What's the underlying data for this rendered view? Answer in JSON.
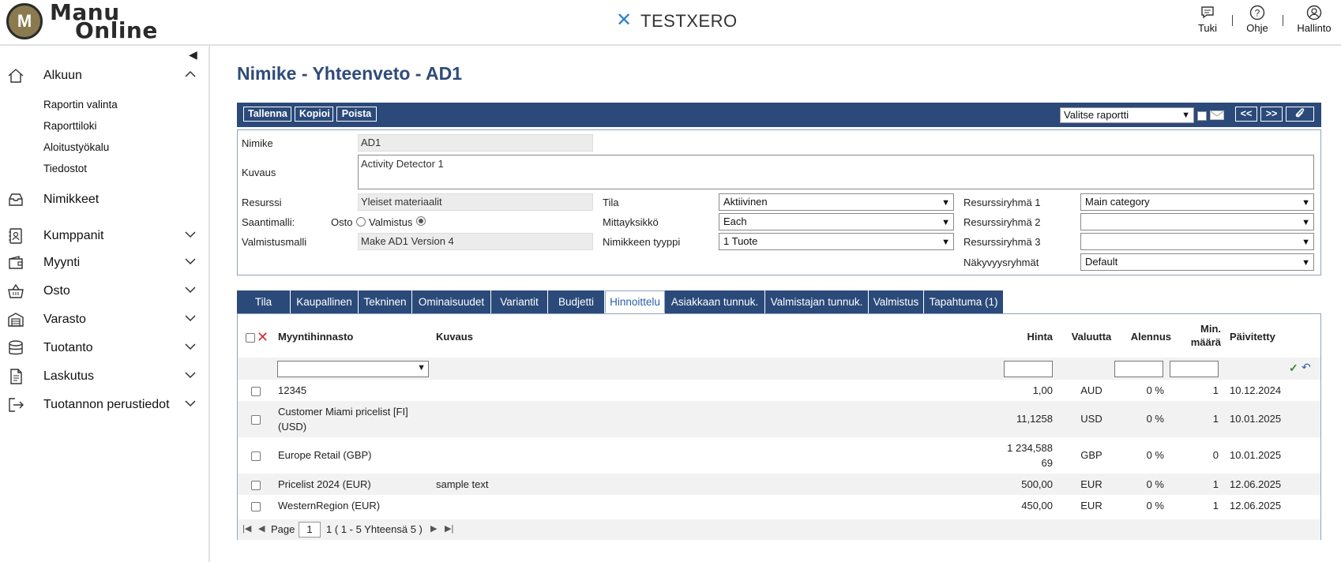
{
  "header": {
    "logo_mark": "M",
    "logo_line1": "Manu",
    "logo_line2": "Online",
    "brand_icon": "⌘",
    "brand_name": "TESTXERO",
    "tools": [
      {
        "label": "Tuki",
        "icon": "chat-icon"
      },
      {
        "label": "Ohje",
        "icon": "help-icon"
      },
      {
        "label": "Hallinto",
        "icon": "user-icon"
      }
    ]
  },
  "sidebar": {
    "collapse_icon": "chevron-left-icon",
    "main": [
      {
        "label": "Alkuun",
        "icon": "home-icon",
        "chevron": "⌃"
      },
      {
        "label": "Nimikkeet",
        "icon": "inbox-icon",
        "chevron": ""
      },
      {
        "label": "Kumppanit",
        "icon": "contacts-icon",
        "chevron": "⌄"
      },
      {
        "label": "Myynti",
        "icon": "wallet-icon",
        "chevron": "⌄"
      },
      {
        "label": "Osto",
        "icon": "basket-icon",
        "chevron": "⌄"
      },
      {
        "label": "Varasto",
        "icon": "warehouse-icon",
        "chevron": "⌄"
      },
      {
        "label": "Tuotanto",
        "icon": "database-icon",
        "chevron": "⌄"
      },
      {
        "label": "Laskutus",
        "icon": "invoice-icon",
        "chevron": "⌄"
      },
      {
        "label": "Tuotannon perustiedot",
        "icon": "exit-icon",
        "chevron": "⌄"
      }
    ],
    "sub": [
      "Raportin valinta",
      "Raporttiloki",
      "Aloitustyökalu",
      "Tiedostot"
    ]
  },
  "page": {
    "title": "Nimike - Yhteenveto - AD1"
  },
  "toolbar": {
    "save": "Tallenna",
    "copy": "Kopioi",
    "delete": "Poista",
    "report_select": "Valitse raportti",
    "prev": "<<",
    "next": ">>",
    "attach": "✎"
  },
  "form": {
    "nimike_label": "Nimike",
    "nimike_value": "AD1",
    "kuvaus_label": "Kuvaus",
    "kuvaus_value": "Activity Detector 1",
    "resurssi_label": "Resurssi",
    "resurssi_value": "Yleiset materiaalit",
    "saantimalli_label": "Saantimalli:",
    "osto_label": "Osto",
    "valmistus_label": "Valmistus",
    "valmistusmalli_label": "Valmistusmalli",
    "valmistusmalli_value": "Make AD1 Version 4",
    "tila_label": "Tila",
    "tila_value": "Aktiivinen",
    "mittayksikko_label": "Mittayksikkö",
    "mittayksikko_value": "Each",
    "tyyppi_label": "Nimikkeen tyyppi",
    "tyyppi_value": "1 Tuote",
    "rr1_label": "Resurssiryhmä 1",
    "rr1_value": "Main category",
    "rr2_label": "Resurssiryhmä 2",
    "rr2_value": "",
    "rr3_label": "Resurssiryhmä 3",
    "rr3_value": "",
    "nakyvyys_label": "Näkyvyysryhmät",
    "nakyvyys_value": "Default"
  },
  "tabs": [
    "Tila",
    "Kaupallinen",
    "Tekninen",
    "Ominaisuudet",
    "Variantit",
    "Budjetti",
    "Hinnoittelu",
    "Asiakkaan tunnuk.",
    "Valmistajan tunnuk.",
    "Valmistus",
    "Tapahtuma (1)"
  ],
  "active_tab": "Hinnoittelu",
  "grid": {
    "headers": {
      "pricelist": "Myyntihinnasto",
      "description": "Kuvaus",
      "price": "Hinta",
      "currency": "Valuutta",
      "discount": "Alennus",
      "minqty_1": "Min.",
      "minqty_2": "määrä",
      "updated": "Päivitetty"
    },
    "rows": [
      {
        "pricelist": "12345",
        "pricelist2": "",
        "description": "",
        "price": "1,00",
        "price2": "",
        "currency": "AUD",
        "discount": "0 %",
        "minqty": "1",
        "updated": "10.12.2024"
      },
      {
        "pricelist": "Customer Miami pricelist [FI]",
        "pricelist2": "(USD)",
        "description": "",
        "price": "11,1258",
        "price2": "",
        "currency": "USD",
        "discount": "0 %",
        "minqty": "1",
        "updated": "10.01.2025"
      },
      {
        "pricelist": "Europe Retail (GBP)",
        "pricelist2": "",
        "description": "",
        "price": "1 234,588",
        "price2": "69",
        "currency": "GBP",
        "discount": "0 %",
        "minqty": "0",
        "updated": "10.01.2025"
      },
      {
        "pricelist": "Pricelist 2024 (EUR)",
        "pricelist2": "",
        "description": "sample text",
        "price": "500,00",
        "price2": "",
        "currency": "EUR",
        "discount": "0 %",
        "minqty": "1",
        "updated": "12.06.2025"
      },
      {
        "pricelist": "WesternRegion (EUR)",
        "pricelist2": "",
        "description": "",
        "price": "450,00",
        "price2": "",
        "currency": "EUR",
        "discount": "0 %",
        "minqty": "1",
        "updated": "12.06.2025"
      }
    ],
    "pager": {
      "page_label": "Page",
      "page_value": "1",
      "summary": "1 ( 1 - 5 Yhteensä 5 )"
    }
  },
  "colors": {
    "accent": "#2b4a7a",
    "title": "#2e4b7a",
    "delete": "#d32f2f",
    "confirm": "#2e8b2e"
  }
}
